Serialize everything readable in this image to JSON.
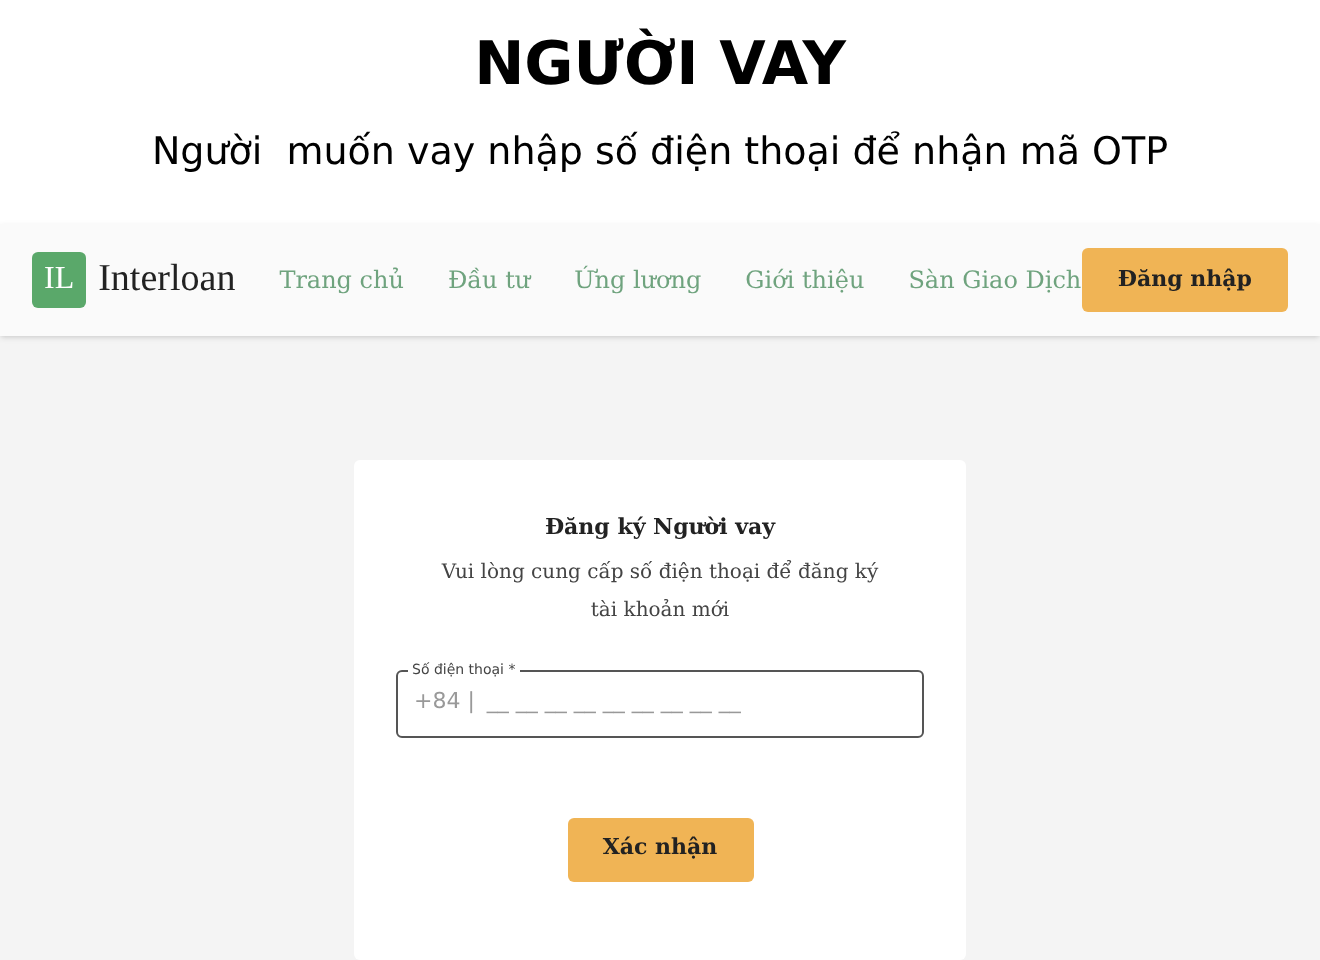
{
  "heading": {
    "title": "NGƯỜI VAY",
    "subtitle": "Người  muốn vay nhập số điện thoại để nhận mã OTP"
  },
  "navbar": {
    "logo_mark": "IL",
    "logo_text": "Interloan",
    "links": [
      "Trang chủ",
      "Đầu tư",
      "Ứng lương",
      "Giới thiệu",
      "Sàn Giao Dịch"
    ],
    "login_button": "Đăng nhập"
  },
  "form": {
    "title": "Đăng ký Người vay",
    "description": "Vui lòng cung cấp số điện thoại để đăng ký tài khoản mới",
    "phone_field": {
      "label": "Số điện thoại *",
      "prefix": "+84 |",
      "placeholder": "__ __ __ __ __ __ __ __ __"
    },
    "submit_button": "Xác nhận"
  }
}
